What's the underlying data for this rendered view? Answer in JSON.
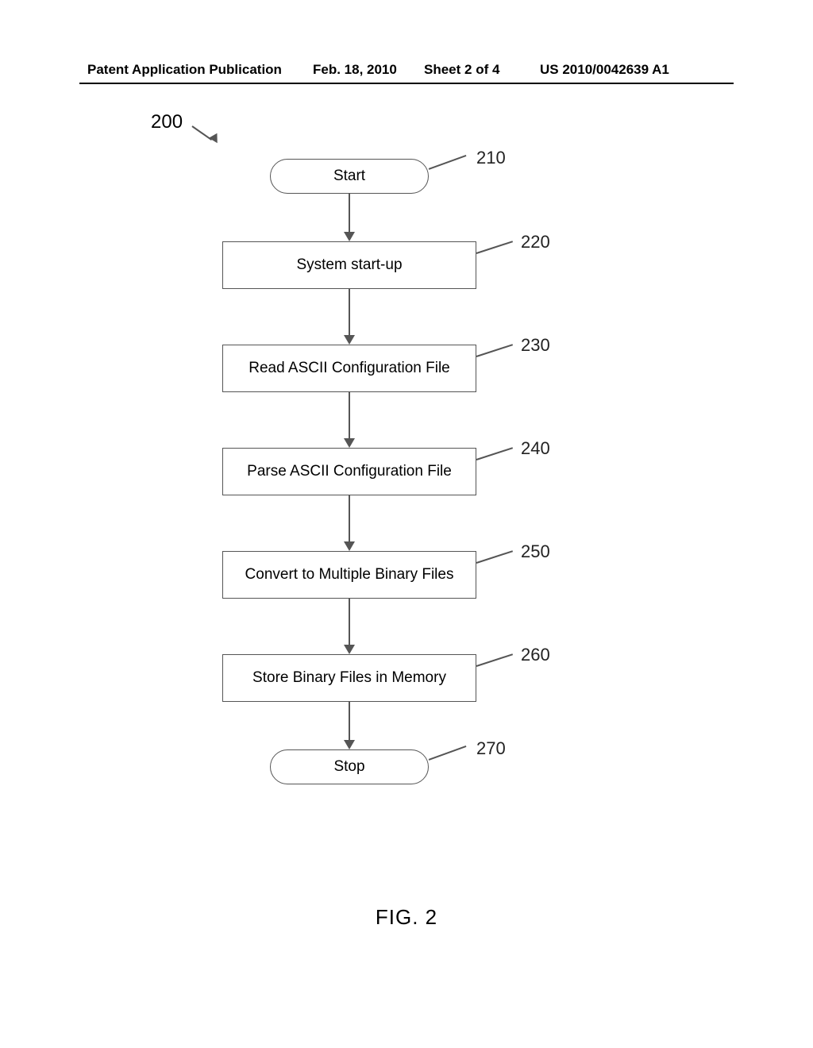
{
  "header": {
    "publication_label": "Patent Application Publication",
    "date": "Feb. 18, 2010",
    "sheet": "Sheet 2 of 4",
    "pub_number": "US 2010/0042639 A1"
  },
  "figure": {
    "title": "FIG. 2",
    "diagram_ref": "200"
  },
  "flowchart": {
    "steps": [
      {
        "ref": "210",
        "shape": "terminator",
        "label": "Start"
      },
      {
        "ref": "220",
        "shape": "rect",
        "label": "System start-up"
      },
      {
        "ref": "230",
        "shape": "rect",
        "label": "Read ASCII Configuration File"
      },
      {
        "ref": "240",
        "shape": "rect",
        "label": "Parse ASCII Configuration File"
      },
      {
        "ref": "250",
        "shape": "rect",
        "label": "Convert to Multiple Binary Files"
      },
      {
        "ref": "260",
        "shape": "rect",
        "label": "Store Binary Files in Memory"
      },
      {
        "ref": "270",
        "shape": "terminator",
        "label": "Stop"
      }
    ]
  }
}
